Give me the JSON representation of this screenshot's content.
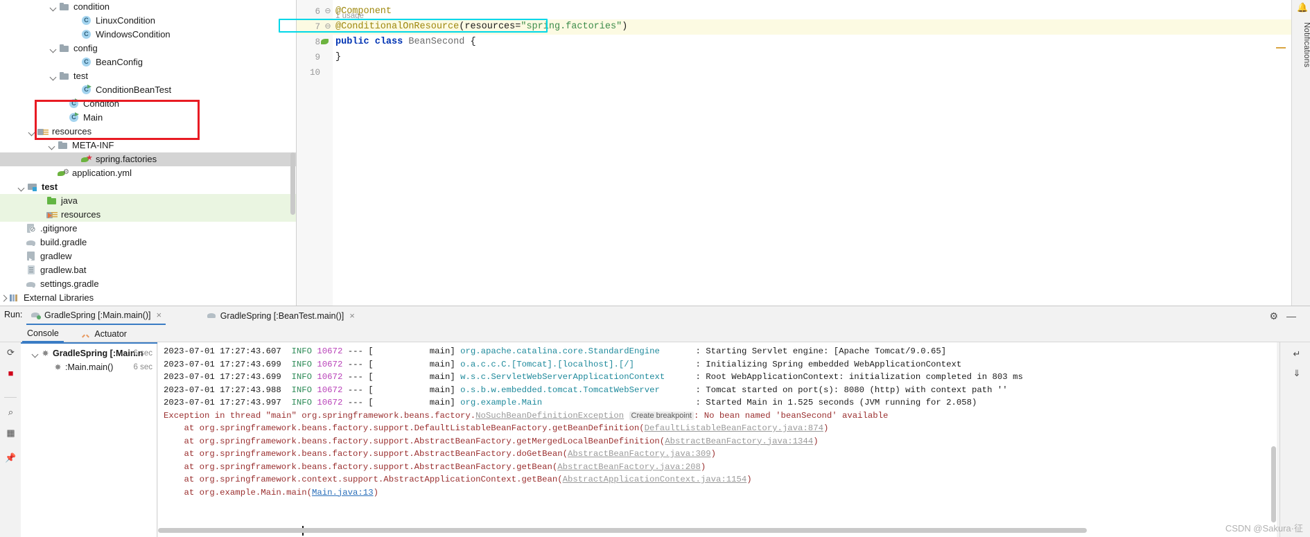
{
  "project_tree": {
    "rows": [
      {
        "indent": 86,
        "arrow": "open",
        "icon": "folder-grey",
        "label": "condition",
        "state": "normal"
      },
      {
        "indent": 118,
        "arrow": "none",
        "icon": "class",
        "label": "LinuxCondition",
        "state": "normal"
      },
      {
        "indent": 118,
        "arrow": "none",
        "icon": "class",
        "label": "WindowsCondition",
        "state": "normal"
      },
      {
        "indent": 86,
        "arrow": "open",
        "icon": "folder-grey",
        "label": "config",
        "state": "normal"
      },
      {
        "indent": 118,
        "arrow": "none",
        "icon": "class",
        "label": "BeanConfig",
        "state": "normal"
      },
      {
        "indent": 86,
        "arrow": "open",
        "icon": "folder-grey",
        "label": "test",
        "state": "normal"
      },
      {
        "indent": 118,
        "arrow": "none",
        "icon": "class-run",
        "label": "ConditionBeanTest",
        "state": "normal"
      },
      {
        "indent": 100,
        "arrow": "none",
        "icon": "class-run",
        "label": "Conditon",
        "state": "normal"
      },
      {
        "indent": 100,
        "arrow": "none",
        "icon": "class-run",
        "label": "Main",
        "state": "normal"
      },
      {
        "indent": 55,
        "arrow": "open",
        "icon": "resources",
        "label": "resources",
        "state": "normal"
      },
      {
        "indent": 84,
        "arrow": "open",
        "icon": "folder-grey",
        "label": "META-INF",
        "state": "normal"
      },
      {
        "indent": 118,
        "arrow": "none",
        "icon": "spring",
        "label": "spring.factories",
        "state": "selected"
      },
      {
        "indent": 84,
        "arrow": "none",
        "icon": "yml",
        "label": "application.yml",
        "state": "normal"
      },
      {
        "indent": 40,
        "arrow": "open",
        "icon": "module",
        "label": "test",
        "state": "bold"
      },
      {
        "indent": 68,
        "arrow": "none",
        "icon": "folder-green",
        "label": "java",
        "state": "green"
      },
      {
        "indent": 68,
        "arrow": "none",
        "icon": "resources2",
        "label": "resources",
        "state": "green"
      },
      {
        "indent": 38,
        "arrow": "none",
        "icon": "gitignore",
        "label": ".gitignore",
        "state": "normal"
      },
      {
        "indent": 38,
        "arrow": "none",
        "icon": "gradle",
        "label": "build.gradle",
        "state": "normal"
      },
      {
        "indent": 38,
        "arrow": "none",
        "icon": "script",
        "label": "gradlew",
        "state": "normal"
      },
      {
        "indent": 38,
        "arrow": "none",
        "icon": "bat",
        "label": "gradlew.bat",
        "state": "normal"
      },
      {
        "indent": 38,
        "arrow": "none",
        "icon": "gradle",
        "label": "settings.gradle",
        "state": "normal"
      },
      {
        "indent": 10,
        "arrow": "closed",
        "icon": "extlib",
        "label": "External Libraries",
        "state": "normal"
      }
    ],
    "highlight_color": "#e81b23"
  },
  "editor": {
    "usage_hint": "1 usage",
    "lines": [
      {
        "num": "6",
        "fold": "⊖",
        "code": "@Component",
        "type": "annotation"
      },
      {
        "num": "7",
        "fold": "⊖",
        "code": "@ConditionalOnResource(resources=\"spring.factories\")",
        "type": "annotation-highlighted"
      },
      {
        "num": "8",
        "fold": "",
        "code": "public class BeanSecond {",
        "type": "declaration"
      },
      {
        "num": "9",
        "fold": "",
        "code": "}",
        "type": "plain"
      },
      {
        "num": "10",
        "fold": "",
        "code": "",
        "type": "plain"
      }
    ],
    "annotation_tokens": {
      "name": "@ConditionalOnResource",
      "open_paren": "(",
      "param": "resources=",
      "value": "\"spring.factories\"",
      "close_paren": ")"
    },
    "class_tokens": {
      "kw1": "public",
      "kw2": "class",
      "name": "BeanSecond",
      "brace": "{"
    },
    "highlight_color": "#00d7e8"
  },
  "notifications": {
    "label": "Notifications",
    "icon": "bell-icon"
  },
  "run_panel": {
    "label": "Run:",
    "tabs": [
      {
        "label": "GradleSpring [:Main.main()]",
        "active": true,
        "running": true,
        "close": "×"
      },
      {
        "label": "GradleSpring [:BeanTest.main()]",
        "active": false,
        "running": false,
        "close": "×"
      }
    ],
    "subtabs": [
      {
        "label": "Console",
        "active": true,
        "icon": "none"
      },
      {
        "label": "Actuator",
        "active": false,
        "icon": "actuator-icon"
      }
    ],
    "gear": "⚙",
    "minimize": "—",
    "left_tools": [
      {
        "name": "rerun-button",
        "glyph": "⟳"
      },
      {
        "name": "stop-button",
        "glyph": "■"
      },
      {
        "name": "filter-button",
        "glyph": "⌕"
      },
      {
        "name": "layout-button",
        "glyph": "▦"
      },
      {
        "name": "pin-button",
        "glyph": "✆"
      }
    ],
    "right_tools": [
      {
        "name": "soft-wrap-button",
        "glyph": "↵"
      },
      {
        "name": "scroll-end-button",
        "glyph": "⤓"
      }
    ],
    "tree": [
      {
        "indent": 16,
        "arrow": "open",
        "label": "GradleSpring [:Main.n",
        "time": "6 sec",
        "bold": true
      },
      {
        "indent": 34,
        "arrow": "none",
        "label": ":Main.main()",
        "time": "6 sec",
        "bold": false
      }
    ]
  },
  "console": {
    "log_lines": [
      {
        "kind": "info",
        "date": "2023-07-01 17:27:43.607",
        "level": "INFO",
        "pid": "10672",
        "dashes": "---",
        "thread": "[           main]",
        "logger": "org.apache.catalina.core.StandardEngine",
        "message": ": Starting Servlet engine: [Apache Tomcat/9.0.65]"
      },
      {
        "kind": "info",
        "date": "2023-07-01 17:27:43.699",
        "level": "INFO",
        "pid": "10672",
        "dashes": "---",
        "thread": "[           main]",
        "logger": "o.a.c.c.C.[Tomcat].[localhost].[/]",
        "message": ": Initializing Spring embedded WebApplicationContext"
      },
      {
        "kind": "info",
        "date": "2023-07-01 17:27:43.699",
        "level": "INFO",
        "pid": "10672",
        "dashes": "---",
        "thread": "[           main]",
        "logger": "w.s.c.ServletWebServerApplicationContext",
        "message": ": Root WebApplicationContext: initialization completed in 803 ms"
      },
      {
        "kind": "info",
        "date": "2023-07-01 17:27:43.988",
        "level": "INFO",
        "pid": "10672",
        "dashes": "---",
        "thread": "[           main]",
        "logger": "o.s.b.w.embedded.tomcat.TomcatWebServer",
        "message": ": Tomcat started on port(s): 8080 (http) with context path ''"
      },
      {
        "kind": "info",
        "date": "2023-07-01 17:27:43.997",
        "level": "INFO",
        "pid": "10672",
        "dashes": "---",
        "thread": "[           main]",
        "logger": "org.example.Main",
        "message": ": Started Main in 1.525 seconds (JVM running for 2.058)"
      }
    ],
    "exception": {
      "prefix": "Exception in thread \"main\" org.springframework.beans.factory.",
      "link": "NoSuchBeanDefinitionException",
      "breakpoint_badge": "Create breakpoint",
      "suffix": ": No bean named 'beanSecond' available"
    },
    "stack_trace": [
      {
        "prefix": "    at org.springframework.beans.factory.support.DefaultListableBeanFactory.getBeanDefinition(",
        "link": "DefaultListableBeanFactory.java:874",
        "suffix": ")",
        "link_style": "grey"
      },
      {
        "prefix": "    at org.springframework.beans.factory.support.AbstractBeanFactory.getMergedLocalBeanDefinition(",
        "link": "AbstractBeanFactory.java:1344",
        "suffix": ")",
        "link_style": "grey"
      },
      {
        "prefix": "    at org.springframework.beans.factory.support.AbstractBeanFactory.doGetBean(",
        "link": "AbstractBeanFactory.java:309",
        "suffix": ")",
        "link_style": "grey"
      },
      {
        "prefix": "    at org.springframework.beans.factory.support.AbstractBeanFactory.getBean(",
        "link": "AbstractBeanFactory.java:208",
        "suffix": ")",
        "link_style": "grey"
      },
      {
        "prefix": "    at org.springframework.context.support.AbstractApplicationContext.getBean(",
        "link": "AbstractApplicationContext.java:1154",
        "suffix": ")",
        "link_style": "grey"
      },
      {
        "prefix": "    at org.example.Main.main(",
        "link": "Main.java:13",
        "suffix": ")",
        "link_style": "blue"
      }
    ]
  },
  "watermark": "CSDN @Sakura·征"
}
